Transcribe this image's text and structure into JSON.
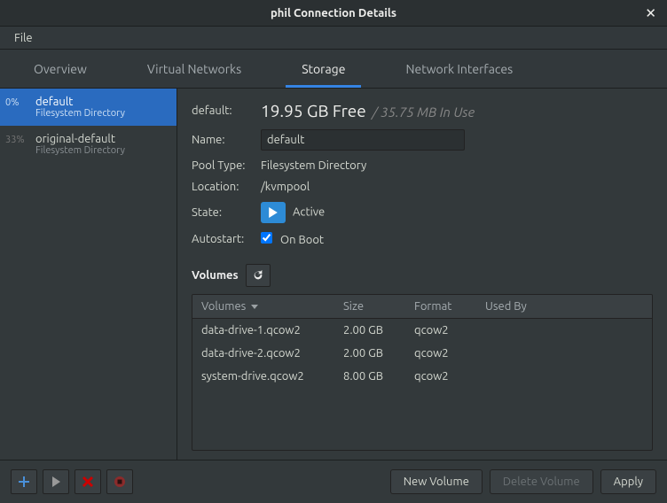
{
  "titlebar": {
    "title": "phil Connection Details"
  },
  "menubar": {
    "file": "File"
  },
  "tabs": {
    "overview": "Overview",
    "virtual_networks": "Virtual Networks",
    "storage": "Storage",
    "network_interfaces": "Network Interfaces"
  },
  "pools": [
    {
      "usage": "0%",
      "name": "default",
      "type": "Filesystem Directory",
      "selected": true
    },
    {
      "usage": "33%",
      "name": "original-default",
      "type": "Filesystem Directory",
      "selected": false
    }
  ],
  "detail": {
    "label_header": "default:",
    "free_value": "19.95 GB Free",
    "inuse_value": "/ 35.75 MB In Use",
    "name_label": "Name:",
    "name_value": "default",
    "pooltype_label": "Pool Type:",
    "pooltype_value": "Filesystem Directory",
    "location_label": "Location:",
    "location_value": "/kvmpool",
    "state_label": "State:",
    "state_value": "Active",
    "autostart_label": "Autostart:",
    "autostart_value": "On Boot",
    "autostart_checked": true,
    "volumes_heading": "Volumes"
  },
  "table": {
    "headers": {
      "volumes": "Volumes",
      "size": "Size",
      "format": "Format",
      "used_by": "Used By"
    },
    "rows": [
      {
        "name": "data-drive-1.qcow2",
        "size": "2.00 GB",
        "format": "qcow2",
        "used_by": ""
      },
      {
        "name": "data-drive-2.qcow2",
        "size": "2.00 GB",
        "format": "qcow2",
        "used_by": ""
      },
      {
        "name": "system-drive.qcow2",
        "size": "8.00 GB",
        "format": "qcow2",
        "used_by": ""
      }
    ]
  },
  "buttons": {
    "new_volume": "New Volume",
    "delete_volume": "Delete Volume",
    "apply": "Apply"
  }
}
